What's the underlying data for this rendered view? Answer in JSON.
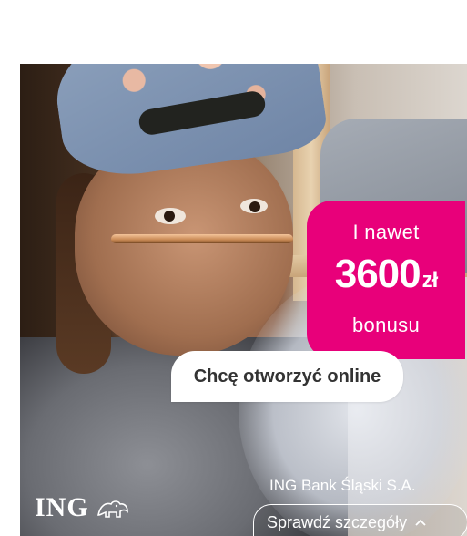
{
  "promo": {
    "line1": "I nawet",
    "amount": "3600",
    "currency": "zł",
    "line3": "bonusu"
  },
  "cta": {
    "label": "Chcę otworzyć online"
  },
  "brand": {
    "logo_text": "ING",
    "logo_icon": "lion-icon",
    "bank_name": "ING Bank Śląski S.A."
  },
  "details": {
    "label": "Sprawdź szczegóły",
    "icon": "chevron-up-icon"
  },
  "colors": {
    "accent": "#e8007a",
    "cta_bg": "#ffffff",
    "cta_text": "#333333"
  }
}
